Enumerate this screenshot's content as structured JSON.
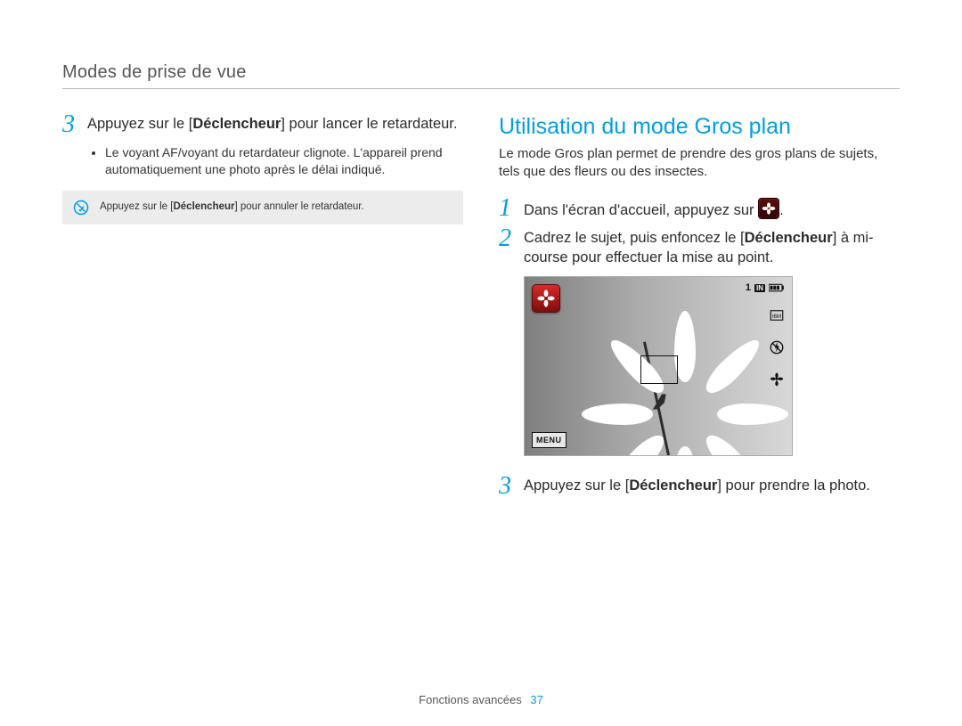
{
  "running_head": "Modes de prise de vue",
  "left": {
    "step3": {
      "num": "3",
      "pre": "Appuyez sur le [",
      "bold": "Déclencheur",
      "post": "] pour lancer le retardateur."
    },
    "bullet1": "Le voyant AF/voyant du retardateur clignote. L'appareil prend automatiquement une photo après le délai indiqué.",
    "note": {
      "pre": "Appuyez sur le [",
      "bold": "Déclencheur",
      "post": "] pour annuler le retardateur."
    }
  },
  "right": {
    "title": "Utilisation du mode Gros plan",
    "intro": "Le mode Gros plan permet de prendre des gros plans de sujets, tels que des fleurs ou des insectes.",
    "step1": {
      "num": "1",
      "pre": "Dans l'écran d'accueil, appuyez sur ",
      "post": "."
    },
    "step2": {
      "num": "2",
      "pre": "Cadrez le sujet, puis enfoncez le [",
      "bold": "Déclencheur",
      "post": "] à mi-course pour effectuer la mise au point."
    },
    "lcd": {
      "menu_label": "MENU",
      "counter": "1",
      "storage_badge": "IN"
    },
    "step3": {
      "num": "3",
      "pre": "Appuyez sur le [",
      "bold": "Déclencheur",
      "post": "] pour prendre la photo."
    }
  },
  "footer": {
    "section": "Fonctions avancées",
    "page": "37"
  }
}
